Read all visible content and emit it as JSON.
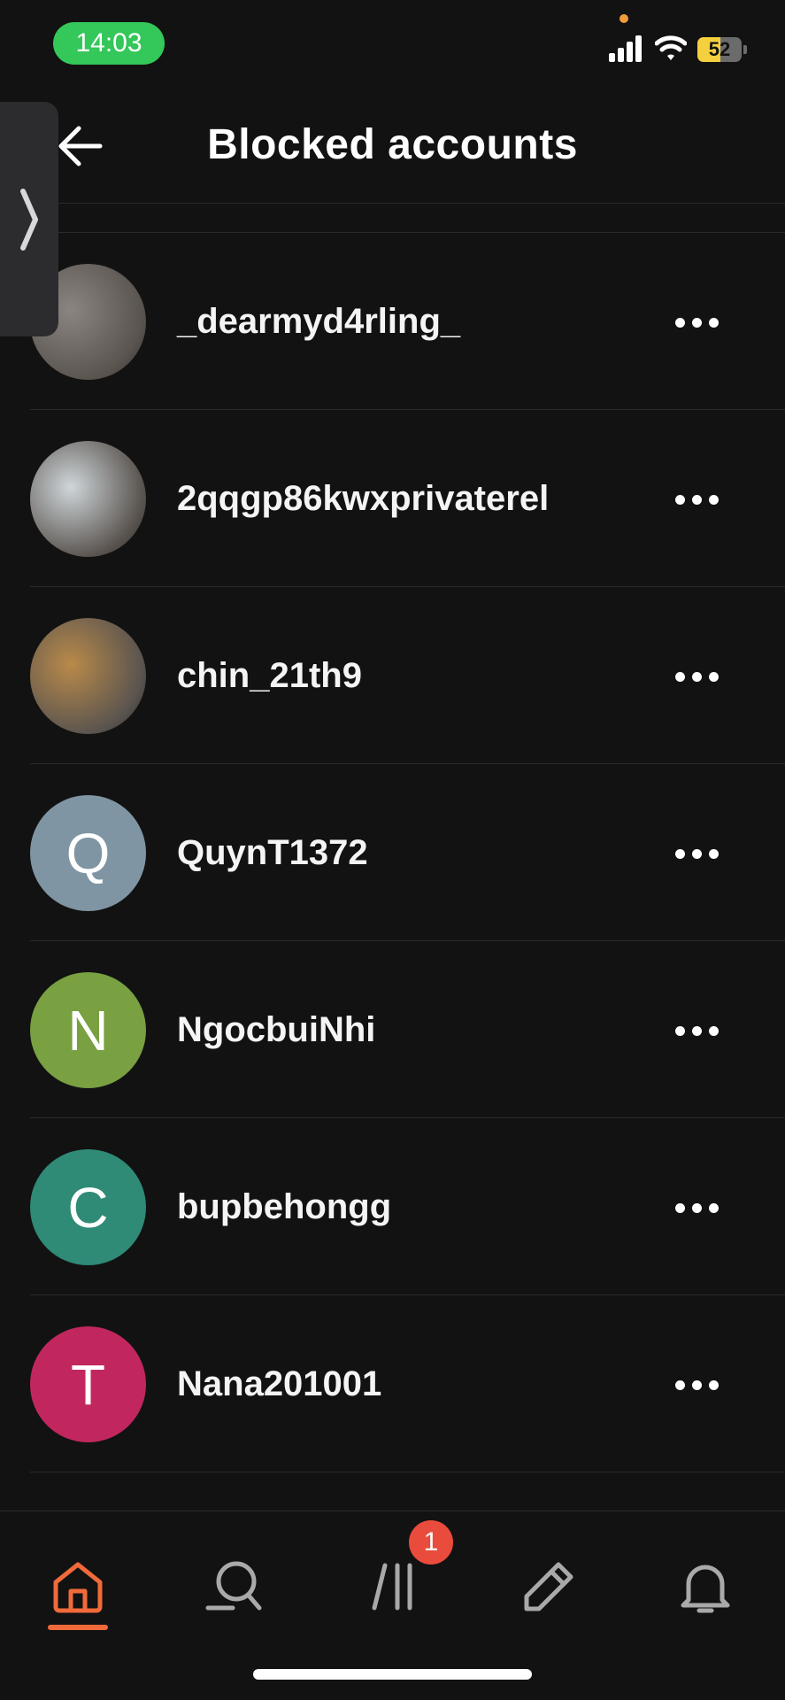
{
  "status_bar": {
    "time": "14:03",
    "battery_level": "52",
    "battery_fraction": 0.52
  },
  "header": {
    "title": "Blocked accounts",
    "back_icon": "arrow-left-icon"
  },
  "side_handle": {
    "icon": "chevron-right-icon"
  },
  "accounts": [
    {
      "username": "",
      "avatar_type": "photo",
      "avatar_color": "#d9cfc9"
    },
    {
      "username": "_dearmyd4rling_",
      "avatar_type": "photo",
      "avatar_color": "#8a8580"
    },
    {
      "username": "2qqgp86kwxprivaterel",
      "avatar_type": "photo",
      "avatar_color": "#cfd6da"
    },
    {
      "username": "chin_21th9",
      "avatar_type": "photo",
      "avatar_color": "#b98a4a"
    },
    {
      "username": "QuynT1372",
      "avatar_type": "initial",
      "initial": "Q",
      "avatar_color": "#7f95a3"
    },
    {
      "username": "NgocbuiNhi",
      "avatar_type": "initial",
      "initial": "N",
      "avatar_color": "#79a041"
    },
    {
      "username": "bupbehongg",
      "avatar_type": "initial",
      "initial": "C",
      "avatar_color": "#2f8a76"
    },
    {
      "username": "Nana201001",
      "avatar_type": "initial",
      "initial": "T",
      "avatar_color": "#c1275e"
    }
  ],
  "more_icon": "more-horizontal-icon",
  "bottom_nav": {
    "items": [
      {
        "name": "home",
        "icon": "home-icon",
        "active": true
      },
      {
        "name": "search",
        "icon": "search-icon",
        "active": false
      },
      {
        "name": "feeds",
        "icon": "feeds-icon",
        "active": false
      },
      {
        "name": "compose",
        "icon": "pencil-icon",
        "active": false
      },
      {
        "name": "notifications",
        "icon": "bell-icon",
        "active": false
      }
    ],
    "feeds_badge": "1",
    "accent_color": "#f06a3a"
  }
}
